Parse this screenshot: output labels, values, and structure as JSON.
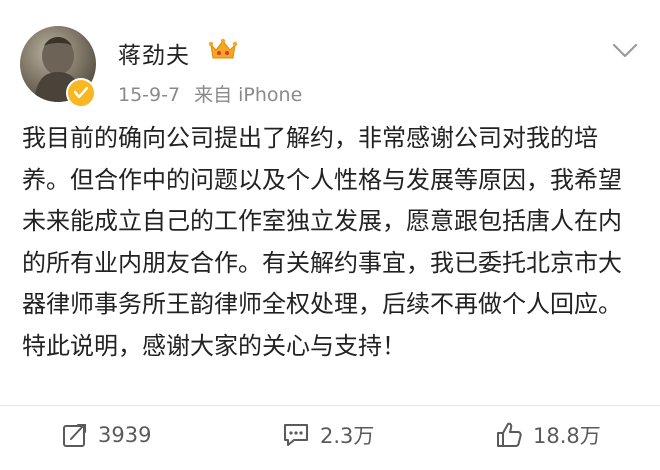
{
  "post": {
    "author": "蒋劲夫",
    "date": "15-9-7",
    "source": "来自 iPhone",
    "content": "我目前的确向公司提出了解约，非常感谢公司对我的培养。但合作中的问题以及个人性格与发展等原因，我希望未来能成立自己的工作室独立发展，愿意跟包括唐人在内的所有业内朋友合作。有关解约事宜，我已委托北京市大器律师事务所王韵律师全权处理，后续不再做个人回应。特此说明，感谢大家的关心与支持！"
  },
  "actions": {
    "repost_count": "3939",
    "comment_count": "2.3万",
    "like_count": "18.8万"
  },
  "icons": {
    "verified": "verified-badge-icon",
    "member": "vip-crown-icon",
    "menu": "chevron-down-icon",
    "repost": "repost-icon",
    "comment": "comment-icon",
    "like": "thumbs-up-icon"
  },
  "colors": {
    "verified_badge": "#f8b723",
    "crown": "#f5a623",
    "text": "#222222",
    "meta": "#8a8a8a"
  }
}
